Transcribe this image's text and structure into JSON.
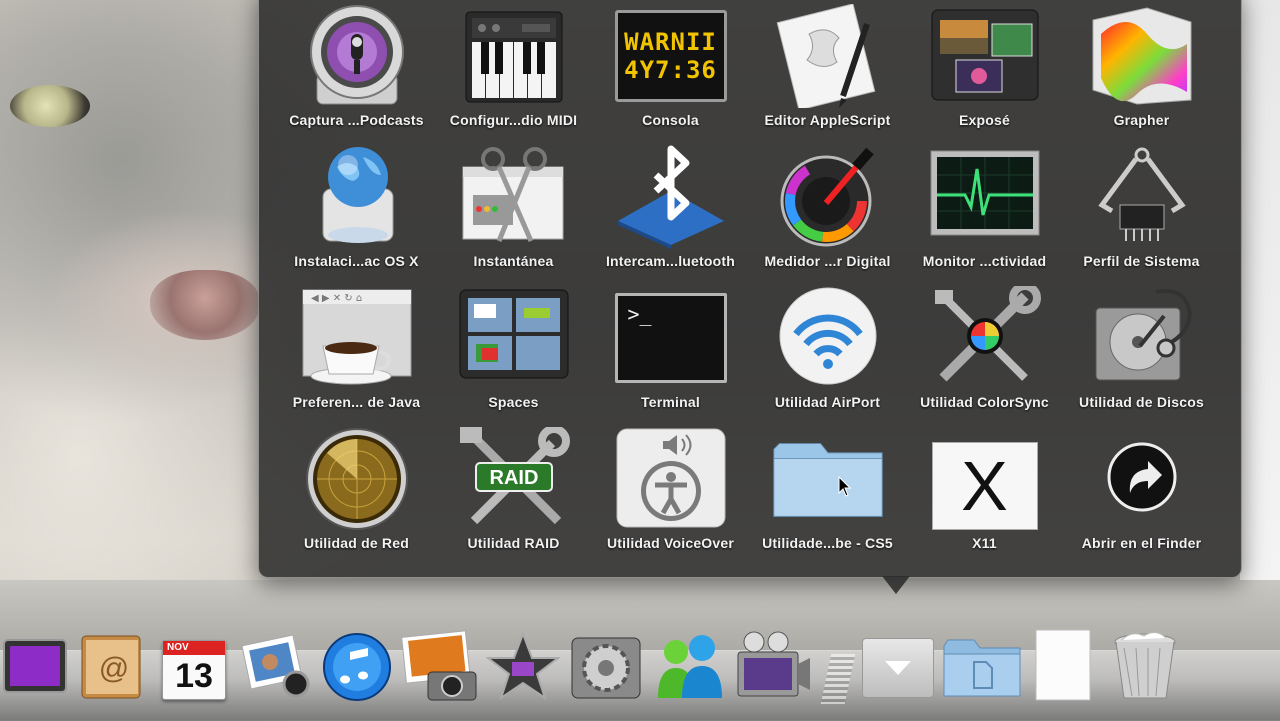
{
  "stack": {
    "items": [
      {
        "label": "Captura ...Podcasts",
        "icon": "podcast-capture-icon"
      },
      {
        "label": "Configur...dio MIDI",
        "icon": "midi-keyboard-icon"
      },
      {
        "label": "Consola",
        "icon": "console-icon",
        "display_line1": "WARNII",
        "display_line2": "4Y7:36"
      },
      {
        "label": "Editor AppleScript",
        "icon": "applescript-scroll-icon"
      },
      {
        "label": "Exposé",
        "icon": "expose-icon"
      },
      {
        "label": "Grapher",
        "icon": "grapher-icon"
      },
      {
        "label": "Instalaci...ac OS X",
        "icon": "installer-globe-icon"
      },
      {
        "label": "Instantánea",
        "icon": "scissors-icon"
      },
      {
        "label": "Intercam...luetooth",
        "icon": "bluetooth-icon"
      },
      {
        "label": "Medidor ...r Digital",
        "icon": "color-meter-icon"
      },
      {
        "label": "Monitor ...ctividad",
        "icon": "activity-monitor-icon"
      },
      {
        "label": "Perfil de Sistema",
        "icon": "system-profiler-icon"
      },
      {
        "label": "Preferen... de Java",
        "icon": "java-cup-icon"
      },
      {
        "label": "Spaces",
        "icon": "spaces-icon"
      },
      {
        "label": "Terminal",
        "icon": "terminal-icon",
        "prompt": ">_"
      },
      {
        "label": "Utilidad AirPort",
        "icon": "airport-wifi-icon"
      },
      {
        "label": "Utilidad ColorSync",
        "icon": "colorsync-icon"
      },
      {
        "label": "Utilidad de Discos",
        "icon": "disk-utility-icon"
      },
      {
        "label": "Utilidad de Red",
        "icon": "network-radar-icon"
      },
      {
        "label": "Utilidad RAID",
        "icon": "raid-tools-icon",
        "badge": "RAID"
      },
      {
        "label": "Utilidad VoiceOver",
        "icon": "voiceover-icon"
      },
      {
        "label": "Utilidade...be - CS5",
        "icon": "folder-icon"
      },
      {
        "label": "X11",
        "icon": "x11-icon",
        "glyph": "X"
      },
      {
        "label": "Abrir en el Finder",
        "icon": "open-in-finder-arrow-icon"
      }
    ]
  },
  "dock": {
    "items": [
      {
        "name": "purple-app",
        "icon": "purple-square-icon"
      },
      {
        "name": "address-book",
        "icon": "address-book-icon",
        "glyph": "@"
      },
      {
        "name": "ical",
        "icon": "calendar-icon",
        "month": "NOV",
        "day": "13"
      },
      {
        "name": "iphoto",
        "icon": "photos-icon"
      },
      {
        "name": "itunes",
        "icon": "itunes-icon"
      },
      {
        "name": "image-capture",
        "icon": "camera-photo-icon"
      },
      {
        "name": "imovie",
        "icon": "imovie-star-icon"
      },
      {
        "name": "system-preferences",
        "icon": "gear-icon"
      },
      {
        "name": "messenger",
        "icon": "messenger-people-icon"
      },
      {
        "name": "video-app",
        "icon": "movie-camera-icon"
      },
      {
        "name": "utilities-stack",
        "icon": "stack-down-arrow-icon"
      },
      {
        "name": "documents",
        "icon": "documents-folder-icon"
      },
      {
        "name": "blank-file",
        "icon": "blank-document-icon"
      },
      {
        "name": "trash",
        "icon": "trash-icon"
      }
    ]
  }
}
